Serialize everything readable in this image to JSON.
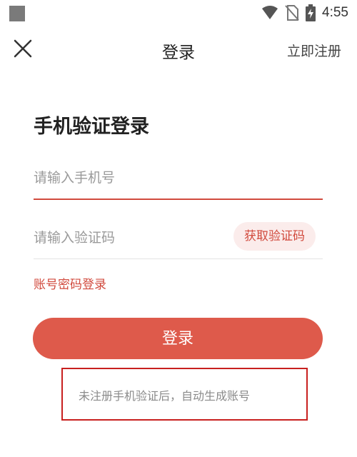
{
  "status_bar": {
    "time": "4:55",
    "icons": [
      "app-square-icon",
      "wifi-icon",
      "no-sim-icon",
      "battery-charging-icon"
    ]
  },
  "header": {
    "title": "登录",
    "register_label": "立即注册",
    "close_icon": "close-icon"
  },
  "form": {
    "heading": "手机验证登录",
    "phone_placeholder": "请输入手机号",
    "code_placeholder": "请输入验证码",
    "get_code_label": "获取验证码",
    "account_login_label": "账号密码登录",
    "login_label": "登录",
    "hint": "未注册手机验证后，自动生成账号"
  },
  "colors": {
    "accent": "#de5a4b",
    "accent_text": "#d14a3d",
    "hint_border": "#c8201f"
  }
}
